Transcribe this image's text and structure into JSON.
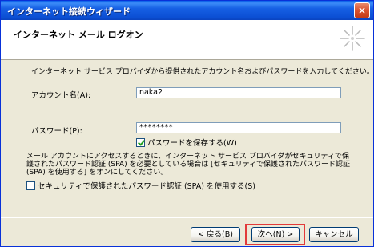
{
  "window": {
    "title": "インターネット接続ウィザード",
    "close_label": "×"
  },
  "header": {
    "title": "インターネット メール ログオン"
  },
  "form": {
    "instruction": "インターネット サービス プロバイダから提供されたアカウント名およびパスワードを入力してください。",
    "account_label": "アカウント名(A):",
    "account_value": "naka2",
    "password_label": "パスワード(P):",
    "password_value": "********",
    "save_password_label": "パスワードを保存する(W)",
    "save_password_checked": true,
    "spa_description": "メール アカウントにアクセスするときに、インターネット サービス プロバイダがセキュリティで保護されたパスワード認証 (SPA) を必要としている場合は [セキュリティで保護されたパスワード認証 (SPA) を使用する] をオンにしてください。",
    "spa_label": "セキュリティで保護されたパスワード認証 (SPA) を使用する(S)",
    "spa_checked": false
  },
  "buttons": {
    "back": "< 戻る(B)",
    "next": "次へ(N) >",
    "cancel": "キャンセル"
  }
}
